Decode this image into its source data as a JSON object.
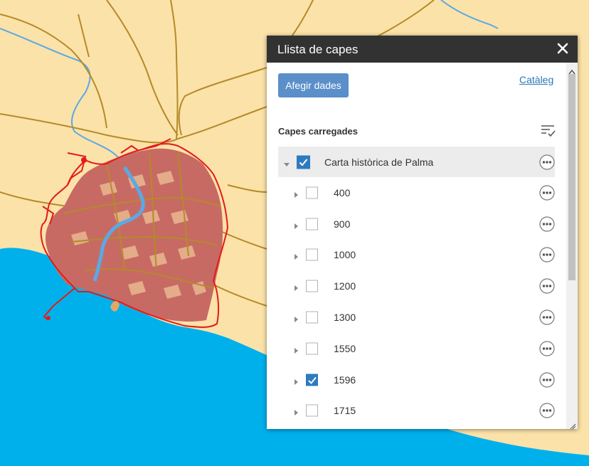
{
  "map": {
    "land_color": "#fbe2a8",
    "sea_color": "#00b0eb",
    "river_color": "#5aa9e6",
    "road_color": "#b58a2a",
    "city_fill": "#c86a64",
    "wall_color": "#e41a1a"
  },
  "panel": {
    "title": "Llista de capes",
    "close_icon": "close-icon",
    "add_button": "Afegir dades",
    "catalog_link": "Catàleg",
    "section_label": "Capes carregades",
    "sort_icon": "sort-checklist-icon"
  },
  "layers": {
    "group": {
      "label": "Carta històrica de Palma",
      "checked": true,
      "expanded": true
    },
    "items": [
      {
        "label": "400",
        "checked": false
      },
      {
        "label": "900",
        "checked": false
      },
      {
        "label": "1000",
        "checked": false
      },
      {
        "label": "1200",
        "checked": false
      },
      {
        "label": "1300",
        "checked": false
      },
      {
        "label": "1550",
        "checked": false
      },
      {
        "label": "1596",
        "checked": true
      },
      {
        "label": "1715",
        "checked": false
      }
    ]
  },
  "accent_color": "#2d7bbf"
}
